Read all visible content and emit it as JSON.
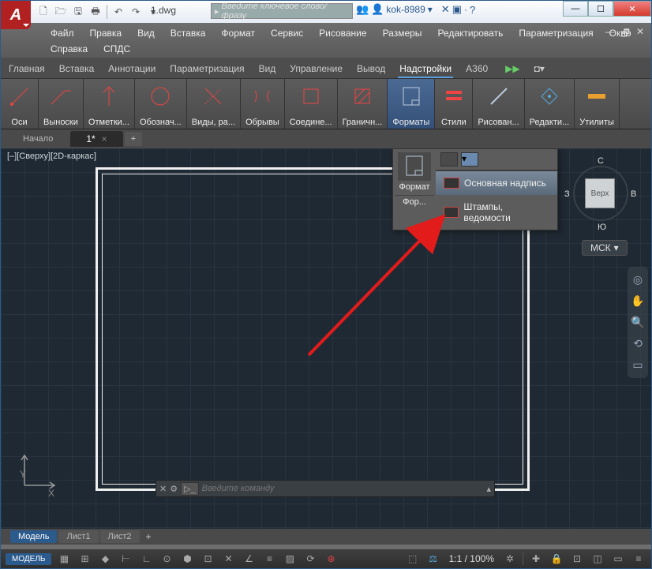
{
  "window": {
    "title": "1.dwg",
    "search_placeholder": "Введите ключевое слово/фразу",
    "user": "kok-8989"
  },
  "menubar": {
    "items": [
      "Файл",
      "Правка",
      "Вид",
      "Вставка",
      "Формат",
      "Сервис",
      "Рисование",
      "Размеры",
      "Редактировать",
      "Параметризация",
      "Окно",
      "Справка",
      "СПДС"
    ]
  },
  "ribbon_tabs": [
    "Главная",
    "Вставка",
    "Аннотации",
    "Параметризация",
    "Вид",
    "Управление",
    "Вывод",
    "Надстройки",
    "A360"
  ],
  "ribbon_panels": [
    {
      "label": "Оси"
    },
    {
      "label": "Выноски"
    },
    {
      "label": "Отметки..."
    },
    {
      "label": "Обознач..."
    },
    {
      "label": "Виды, ра..."
    },
    {
      "label": "Обрывы"
    },
    {
      "label": "Соедине..."
    },
    {
      "label": "Граничн..."
    },
    {
      "label": "Форматы",
      "active": true
    },
    {
      "label": "Стили"
    },
    {
      "label": "Рисован..."
    },
    {
      "label": "Редакти..."
    },
    {
      "label": "Утилиты"
    }
  ],
  "doc_tabs": {
    "items": [
      {
        "label": "Начало"
      },
      {
        "label": "1*",
        "active": true
      }
    ]
  },
  "viewport": {
    "label": "[–][Сверху][2D-каркас]"
  },
  "dropdown": {
    "main_label": "Формат",
    "sub_label": "Фор...",
    "items": [
      {
        "label": "Основная надпись",
        "hover": true
      },
      {
        "label": "Штампы, ведомости"
      }
    ]
  },
  "viewcube": {
    "center": "Верх",
    "n": "С",
    "s": "Ю",
    "e": "В",
    "w": "З",
    "wcs": "МСК"
  },
  "command": {
    "placeholder": "Введите команду"
  },
  "model_tabs": {
    "items": [
      {
        "label": "Модель",
        "active": true
      },
      {
        "label": "Лист1"
      },
      {
        "label": "Лист2"
      }
    ]
  },
  "status": {
    "model": "МОДЕЛЬ",
    "scale": "1:1 / 100%"
  }
}
